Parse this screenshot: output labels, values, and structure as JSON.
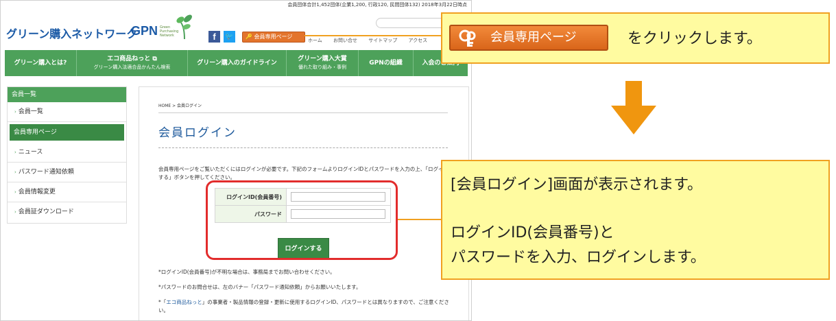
{
  "header": {
    "top_info": "会員団体合計1,452団体(企業1,200, 行政120, 民間団体132) 2018年3月22日時点",
    "logo_text": "グリーン購入ネットワーク",
    "logo_gpn": "GPN",
    "logo_sub": "Green Purchasing Network",
    "member_page_button": "会員専用ページ",
    "util_links": [
      "ホーム",
      "お問い合せ",
      "サイトマップ",
      "アクセス"
    ]
  },
  "global_nav": [
    {
      "label": "グリーン購入とは?",
      "sub": ""
    },
    {
      "label": "エコ商品ねっと ⧉",
      "sub": "グリーン購入法適合品かんたん検索"
    },
    {
      "label": "グリーン購入のガイドライン",
      "sub": ""
    },
    {
      "label": "グリーン購入大賞",
      "sub": "優れた取り組み・事例"
    },
    {
      "label": "GPNの組織",
      "sub": ""
    },
    {
      "label": "入会のご案内",
      "sub": ""
    }
  ],
  "sidebar": {
    "heading": "会員一覧",
    "items": [
      "会員一覧",
      "会員専用ページ",
      "ニュース",
      "パスワード通知依頼",
      "会員情報変更",
      "会員証ダウンロード"
    ]
  },
  "main": {
    "breadcrumb": "HOME > 会員ログイン",
    "title": "会員ログイン",
    "intro": "会員専用ページをご覧いただくにはログインが必要です。下記のフォームよりログインIDとパスワードを入力の上、「ログインする」ボタンを押してください。",
    "form": {
      "id_label": "ログインID(会員番号)",
      "password_label": "パスワード",
      "submit": "ログインする"
    },
    "notes": {
      "note1": "*ログインID(会員番号)が不明な場合は、事務局までお問い合わせください。",
      "note2": "*パスワードのお問合せは、左のバナー「パスワード通知依頼」からお願いいたします。",
      "note3_prefix": "*「",
      "note3_link": "エコ商品ねっと",
      "note3_suffix": "」の事業者・製品情報の登録・更新に使用するログインID、パスワードとは異なりますので、ご注意ください。"
    }
  },
  "callouts": {
    "button_label": "会員専用ページ",
    "click_text": "をクリックします。",
    "screen_text": "[会員ログイン]画面が表示されます。",
    "instruction_line1": "ログインID(会員番号)と",
    "instruction_line2": "パスワードを入力、ログインします。"
  },
  "colors": {
    "nav_green": "#4da15a",
    "callout_fill": "#fffba0",
    "callout_border": "#f0a020",
    "highlight_red": "#e22c2c",
    "orange_button": "#e3742c"
  }
}
